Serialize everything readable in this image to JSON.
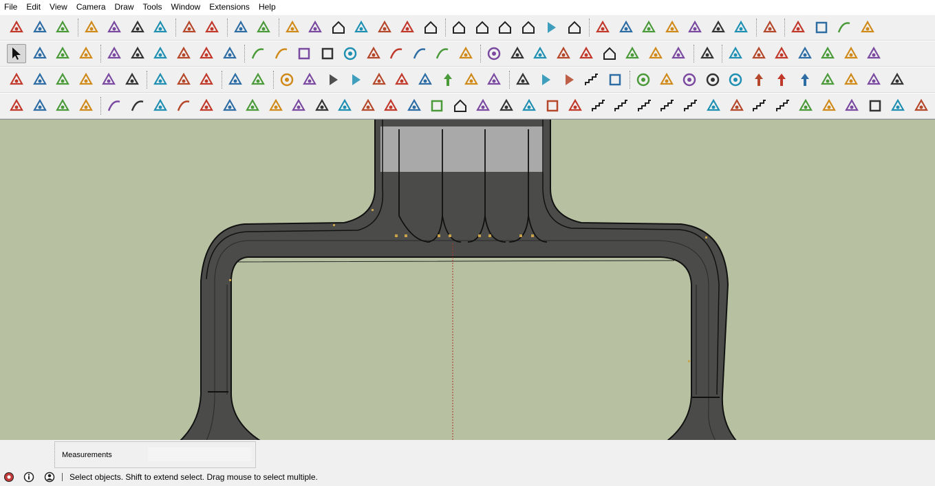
{
  "menubar": {
    "items": [
      "File",
      "Edit",
      "View",
      "Camera",
      "Draw",
      "Tools",
      "Window",
      "Extensions",
      "Help"
    ]
  },
  "toolbars": {
    "row1": [
      "new-model-icon",
      "open-folder-icon",
      "save-icon",
      "cut-icon",
      "copy-icon",
      "paste-icon",
      "erase-icon",
      "undo-icon",
      "redo-icon",
      "print-icon",
      "model-info-icon",
      "get-models-icon",
      "share-model-icon",
      "get-models-warehouse-icon",
      "add-location-icon",
      "toggle-terrain-icon",
      "photo-textures-icon",
      "extension-warehouse-icon",
      "iso-view-icon",
      "top-view-icon",
      "front-view-icon",
      "right-view-icon",
      "back-view-icon",
      "left-view-icon",
      "camera-1-icon",
      "camera-2-icon",
      "camera-3-icon",
      "camera-4-icon",
      "camera-5-icon",
      "camera-6-icon",
      "camera-delete-icon",
      "section-plane-icon",
      "xray-icon",
      "wireframe-icon",
      "hidden-line-icon",
      "shaded-icon"
    ],
    "row2": [
      "select-icon",
      "make-component-icon",
      "paint-bucket-icon",
      "eraser-icon",
      "move-icon",
      "push-pull-icon",
      "rotate-icon",
      "follow-me-icon",
      "scale-icon",
      "offset-icon",
      "line-icon",
      "freehand-icon",
      "rectangle-icon",
      "rotated-rectangle-icon",
      "circle-icon",
      "polygon-icon",
      "arc-icon",
      "two-point-arc-icon",
      "three-point-arc-icon",
      "pie-icon",
      "orbit-icon",
      "pan-icon",
      "zoom-icon",
      "zoom-window-icon",
      "zoom-extents-icon",
      "previous-view-icon",
      "position-camera-icon",
      "look-around-icon",
      "walk-icon",
      "dimension-icon",
      "materials-icon",
      "axes-icon",
      "section-fill-icon",
      "tag-icon",
      "gear-icon",
      "fix-icon",
      "export-icon"
    ],
    "row3": [
      "tape-measure-icon",
      "dimension-tool-icon",
      "protractor-icon",
      "text-icon",
      "axes-tool-icon",
      "3d-text-icon",
      "outer-shell-icon",
      "intersect-icon",
      "union-icon",
      "scenes-icon",
      "layers-icon",
      "record-icon",
      "movie-camera-icon",
      "play-icon",
      "reverse-icon",
      "pause-icon",
      "rewind-icon",
      "stop-icon",
      "s-up-icon",
      "s-down-icon",
      "close-x-icon",
      "ui-icon",
      "forward-icon",
      "fast-back-icon",
      "step-2-icon",
      "stop-square-icon",
      "cycle-icon",
      "pick-icon",
      "loop-a-icon",
      "loop-b-icon",
      "loop-c-icon",
      "arrow-up-down-icon",
      "arrow-vertical-green-icon",
      "arrow-up-red-icon",
      "coil-icon",
      "axis-icon",
      "figure-icon",
      "more-icon"
    ],
    "row4": [
      "sandbox-from-contours-icon",
      "sandbox-from-scratch-icon",
      "sandbox-smoove-icon",
      "sandbox-stamp-icon",
      "curve-polyline-icon",
      "curve-bezier-icon",
      "road-icon",
      "cut-curve-icon",
      "round-corner-icon",
      "shape-bender-icon",
      "bend-icon",
      "extrude-icon",
      "lathe-icon",
      "loft-icon",
      "angle-1-icon",
      "angle-2-icon",
      "angle-3-icon",
      "plane-icon",
      "frame-icon",
      "roof-icon",
      "columns-icon",
      "tube-array-icon",
      "dome-icon",
      "panel-icon",
      "corner-icon",
      "stack-icon",
      "ramp-icon",
      "stairs-1-icon",
      "stairs-2-icon",
      "stairs-3-icon",
      "spiral-icon",
      "slope-icon",
      "step-icon",
      "steps-icon",
      "rail-icon",
      "wall-icon",
      "beam-icon",
      "grid-icon",
      "louver-icon",
      "vent-icon",
      "crate-icon"
    ]
  },
  "viewport": {
    "background": "#b7c1a1",
    "road_color": "#4b4b49",
    "edge_color": "#111111",
    "guide_color": "#b0302a"
  },
  "measurements": {
    "label": "Measurements",
    "value": ""
  },
  "statusbar": {
    "icons": [
      "geolocation-icon",
      "credits-icon",
      "account-icon"
    ],
    "text": "Select objects. Shift to extend select. Drag mouse to select multiple."
  }
}
